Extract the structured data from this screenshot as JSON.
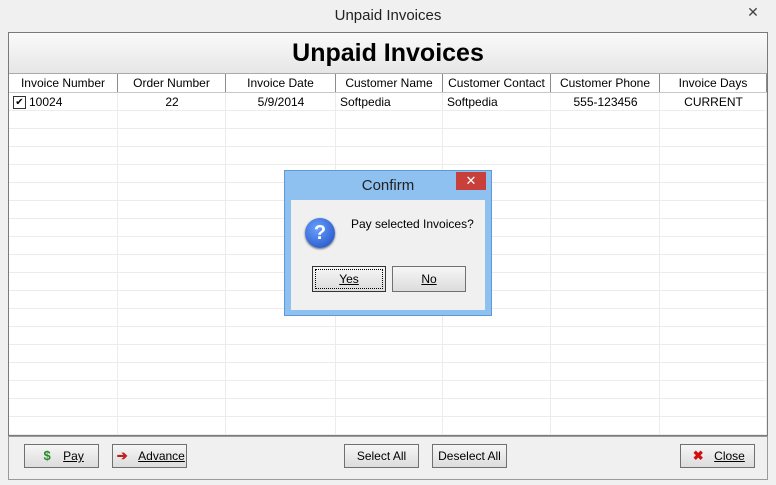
{
  "window": {
    "title": "Unpaid Invoices",
    "close_glyph": "✕"
  },
  "header": {
    "title": "Unpaid Invoices"
  },
  "columns": [
    "Invoice Number",
    "Order Number",
    "Invoice Date",
    "Customer Name",
    "Customer Contact",
    "Customer Phone",
    "Invoice Days"
  ],
  "rows": [
    {
      "checked": true,
      "invoice_number": "10024",
      "order_number": "22",
      "invoice_date": "5/9/2014",
      "customer_name": "Softpedia",
      "customer_contact": "Softpedia",
      "customer_phone": "555-123456",
      "invoice_days": "CURRENT"
    }
  ],
  "footer": {
    "pay_label": "Pay",
    "advance_label": "Advance",
    "select_all_label": "Select All",
    "deselect_all_label": "Deselect All",
    "close_label": "Close"
  },
  "dialog": {
    "title": "Confirm",
    "close_glyph": "✕",
    "message": "Pay selected Invoices?",
    "icon": "question-icon",
    "icon_glyph": "?",
    "yes_label": "Yes",
    "no_label": "No"
  },
  "icons": {
    "pay": "money-icon",
    "advance": "advance-icon",
    "close": "red-x-icon"
  },
  "colors": {
    "dialog_frame": "#8ec0f0",
    "dialog_close": "#c9403a",
    "close_x": "#d01010",
    "money": "#2a8a2a"
  }
}
